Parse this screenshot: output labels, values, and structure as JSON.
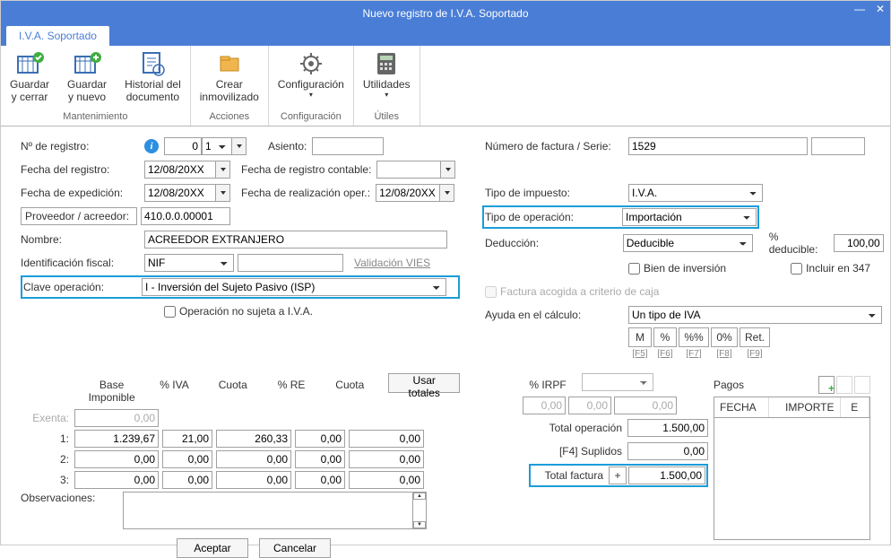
{
  "window": {
    "title": "Nuevo registro de I.V.A. Soportado"
  },
  "tab": "I.V.A. Soportado",
  "ribbon": {
    "mantenimiento": {
      "label": "Mantenimiento",
      "guardar_cerrar": "Guardar\ny cerrar",
      "guardar_nuevo": "Guardar\ny nuevo",
      "historial": "Historial del\ndocumento"
    },
    "acciones": {
      "label": "Acciones",
      "crear": "Crear\ninmovilizado"
    },
    "config": {
      "label": "Configuración",
      "item": "Configuración"
    },
    "utiles": {
      "label": "Útiles",
      "item": "Utilidades"
    }
  },
  "left": {
    "n_registro": "Nº de registro:",
    "n_registro_v": "0",
    "n_registro_s": "1",
    "asiento": "Asiento:",
    "fecha_reg": "Fecha del registro:",
    "fecha_reg_v": "12/08/20XX",
    "fecha_reg_cont": "Fecha de registro contable:",
    "fecha_exp": "Fecha de expedición:",
    "fecha_exp_v": "12/08/20XX",
    "fecha_real": "Fecha de realización oper.:",
    "fecha_real_v": "12/08/20XX",
    "proveedor": "Proveedor / acreedor:",
    "proveedor_v": "410.0.0.00001",
    "nombre": "Nombre:",
    "nombre_v": "ACREEDOR EXTRANJERO",
    "ident": "Identificación fiscal:",
    "ident_type": "NIF",
    "vies": "Validación VIES",
    "clave": "Clave operación:",
    "clave_v": "I - Inversión del Sujeto Pasivo (ISP)",
    "no_sujeta": "Operación no sujeta a I.V.A."
  },
  "right": {
    "num_factura": "Número de factura / Serie:",
    "num_factura_v": "1529",
    "tipo_imp": "Tipo de impuesto:",
    "tipo_imp_v": "I.V.A.",
    "tipo_op": "Tipo de operación:",
    "tipo_op_v": "Importación",
    "deduccion": "Deducción:",
    "deduccion_v": "Deducible",
    "pct_deducible": "% deducible:",
    "pct_deducible_v": "100,00",
    "bien_inv": "Bien de inversión",
    "incluir347": "Incluir en 347",
    "criterio_caja": "Factura acogida a criterio de caja",
    "ayuda": "Ayuda en el cálculo:",
    "ayuda_v": "Un tipo de IVA",
    "calc": [
      "M",
      "%",
      "%%",
      "0%",
      "Ret."
    ],
    "calc_help": [
      "[F5]",
      "[F6]",
      "[F7]",
      "[F8]",
      "[F9]"
    ]
  },
  "gridhdr": {
    "base": "Base Imponible",
    "iva": "% IVA",
    "cuota": "Cuota",
    "re": "% RE",
    "cuota2": "Cuota",
    "usar": "Usar totales",
    "irpf": "% IRPF",
    "pagos": "Pagos"
  },
  "rows": {
    "exenta": "Exenta:",
    "exenta_v": "0,00",
    "r1": "1:",
    "r2": "2:",
    "r3": "3:",
    "b1": "1.239,67",
    "i1": "21,00",
    "c1": "260,33",
    "re1": "0,00",
    "cc1": "0,00",
    "b2": "0,00",
    "i2": "0,00",
    "c2": "0,00",
    "re2": "0,00",
    "cc2": "0,00",
    "b3": "0,00",
    "i3": "0,00",
    "c3": "0,00",
    "re3": "0,00",
    "cc3": "0,00",
    "irpf1": "0,00",
    "irpf2": "0,00",
    "irpf3": "0,00"
  },
  "totals": {
    "total_op": "Total operación",
    "total_op_v": "1.500,00",
    "suplidos": "[F4] Suplidos",
    "suplidos_v": "0,00",
    "total_fact": "Total factura",
    "total_fact_v": "1.500,00"
  },
  "pagos": {
    "fecha": "FECHA",
    "importe": "IMPORTE",
    "e": "E"
  },
  "obs": "Observaciones:",
  "btns": {
    "aceptar": "Aceptar",
    "cancelar": "Cancelar"
  }
}
